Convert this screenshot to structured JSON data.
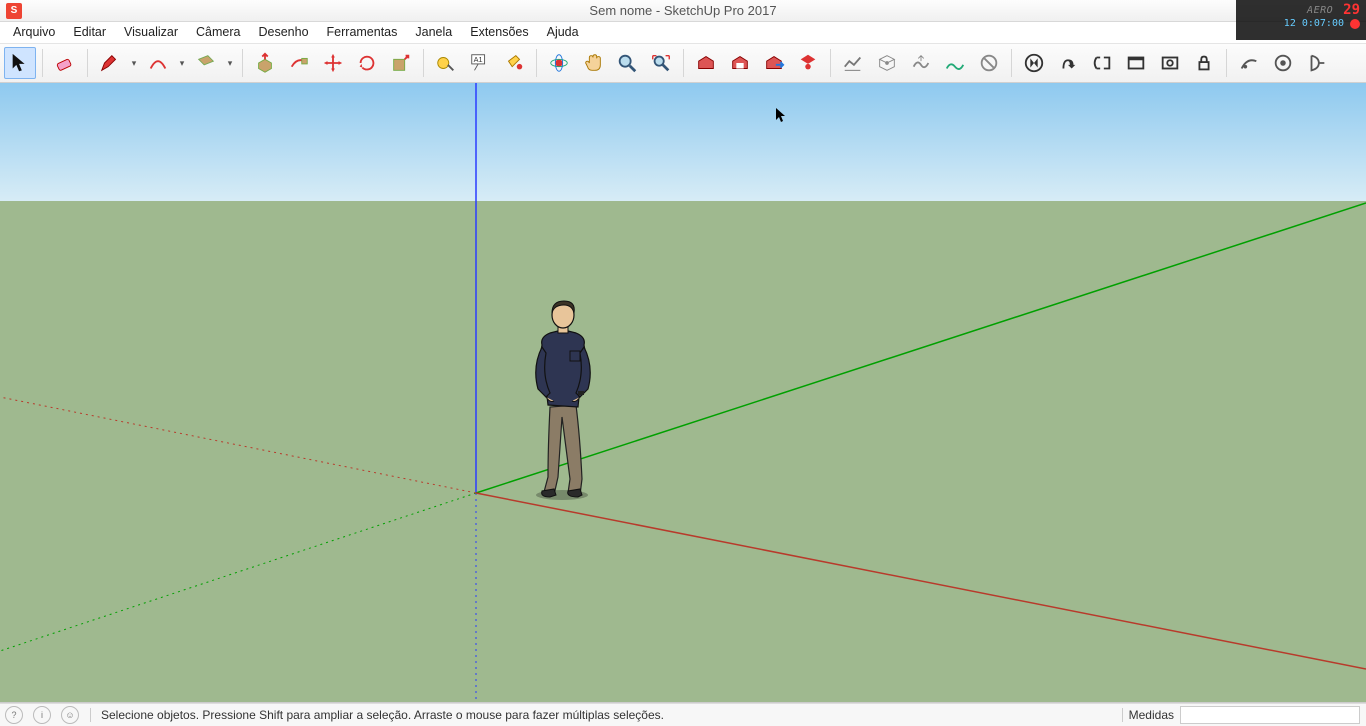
{
  "window": {
    "title": "Sem nome - SketchUp Pro 2017"
  },
  "recorder": {
    "brand": "AERO",
    "num": "29",
    "fps": "12",
    "time": "0:07:00"
  },
  "menu": {
    "items": [
      "Arquivo",
      "Editar",
      "Visualizar",
      "Câmera",
      "Desenho",
      "Ferramentas",
      "Janela",
      "Extensões",
      "Ajuda"
    ]
  },
  "tools": {
    "select": "select-tool",
    "eraser": "eraser-tool",
    "pencil": "pencil-tool",
    "arc": "arc-tool",
    "rectangle": "rectangle-tool",
    "pushpull": "pushpull-tool",
    "followme": "followme-tool",
    "move": "move-tool",
    "rotate": "rotate-tool",
    "scale": "scale-tool",
    "tape": "tape-measure-tool",
    "text": "text-tool",
    "paint": "paint-bucket-tool",
    "orbit": "orbit-tool",
    "pan": "pan-tool",
    "zoom": "zoom-tool",
    "zoomext": "zoom-extents-tool"
  },
  "status": {
    "hint": "Selecione objetos. Pressione Shift para ampliar a seleção. Arraste o mouse para fazer múltiplas seleções.",
    "measurements_label": "Medidas",
    "measurements_value": ""
  },
  "colors": {
    "sky_top": "#9dd3f0",
    "sky_bot": "#d7ecf6",
    "ground": "#9fb98f",
    "axis_blue": "#2a3cff",
    "axis_green": "#00a000",
    "axis_red": "#b83a2b"
  }
}
